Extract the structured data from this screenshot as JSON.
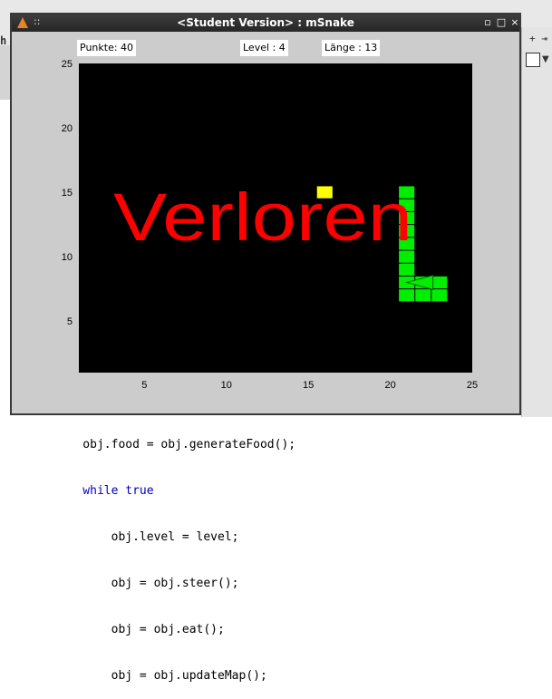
{
  "window": {
    "title": "<Student Version> : mSnake",
    "buttons": {
      "minimize": "▫",
      "maximize": "□",
      "close": "×"
    }
  },
  "hud": {
    "points": "Punkte: 40",
    "level": "Level : 4",
    "length": "Länge : 13"
  },
  "game": {
    "message": "Verloren",
    "message_color": "#ff0000",
    "snake_color": "#00ee00",
    "food_color": "#ffff00",
    "board_color": "#000000",
    "snake_cells": [
      [
        21,
        15
      ],
      [
        21,
        14
      ],
      [
        21,
        13
      ],
      [
        21,
        12
      ],
      [
        21,
        11
      ],
      [
        21,
        10
      ],
      [
        21,
        9
      ],
      [
        21,
        8
      ],
      [
        21,
        7
      ],
      [
        22,
        7
      ],
      [
        23,
        7
      ],
      [
        23,
        8
      ],
      [
        22,
        8
      ]
    ],
    "snake_head": [
      22,
      8
    ],
    "food_cell": [
      16,
      15
    ]
  },
  "chart_data": {
    "type": "scatter",
    "xlim": [
      1,
      25
    ],
    "ylim": [
      1,
      25
    ],
    "x_ticks": [
      5,
      10,
      15,
      20,
      25
    ],
    "y_ticks": [
      5,
      10,
      15,
      20,
      25
    ]
  },
  "background": {
    "left_char": "h",
    "right_icons": "+ ⇥",
    "code_lines": [
      "    obj.food = obj.generateFood();",
      "    while true",
      "        obj.level = level;",
      "        obj = obj.steer();",
      "        obj = obj.eat();",
      "        obj = obj.updateMap();"
    ]
  }
}
